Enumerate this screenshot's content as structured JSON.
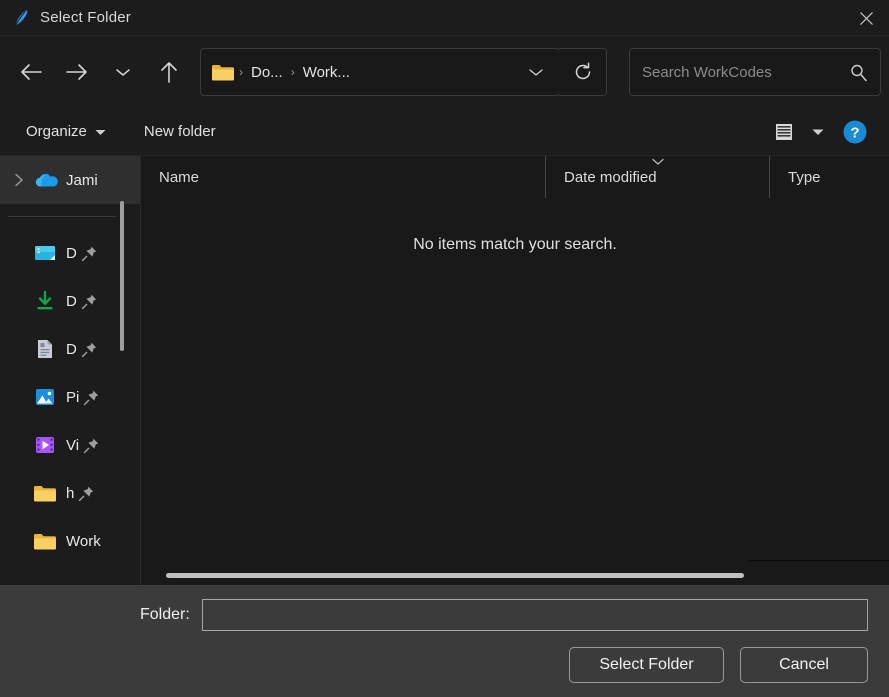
{
  "window": {
    "title": "Select Folder",
    "app_icon": "feather-icon",
    "close_label": "✕"
  },
  "nav": {
    "back": "back-arrow-icon",
    "forward": "forward-arrow-icon",
    "recent": "chevron-down-icon",
    "up": "up-arrow-icon",
    "refresh": "refresh-icon"
  },
  "address": {
    "folder_icon": "folder-icon",
    "crumbs": [
      "Do...",
      "Work..."
    ],
    "separator": "›",
    "dropdown": "chevron-down-icon"
  },
  "search": {
    "placeholder": "Search WorkCodes",
    "value": "",
    "icon": "search-icon"
  },
  "toolbar": {
    "organize_label": "Organize",
    "organize_caret": "caret-down-icon",
    "new_folder_label": "New folder",
    "layout_icon": "list-view-icon",
    "layout_caret": "caret-down-icon",
    "help_label": "?"
  },
  "sidebar": {
    "items": [
      {
        "label": "Jami",
        "icon": "onedrive-cloud-icon",
        "expandable": true,
        "selected": true,
        "pinned": false
      },
      {
        "label": "D",
        "icon": "desktop-icon",
        "expandable": false,
        "selected": false,
        "pinned": true
      },
      {
        "label": "D",
        "icon": "downloads-icon",
        "expandable": false,
        "selected": false,
        "pinned": true
      },
      {
        "label": "D",
        "icon": "documents-icon",
        "expandable": false,
        "selected": false,
        "pinned": true
      },
      {
        "label": "Pi",
        "icon": "pictures-icon",
        "expandable": false,
        "selected": false,
        "pinned": true
      },
      {
        "label": "Vi",
        "icon": "videos-icon",
        "expandable": false,
        "selected": false,
        "pinned": true
      },
      {
        "label": "h",
        "icon": "folder-icon",
        "expandable": false,
        "selected": false,
        "pinned": true
      },
      {
        "label": "Work",
        "icon": "folder-icon",
        "expandable": false,
        "selected": false,
        "pinned": false
      }
    ]
  },
  "filelist": {
    "columns": [
      "Name",
      "Date modified",
      "Type"
    ],
    "sorted_column": "Date modified",
    "sort_indicator": "chevron-up-icon",
    "rows": [],
    "empty_message": "No items match your search."
  },
  "footer": {
    "folder_label": "Folder:",
    "folder_value": "",
    "select_label": "Select Folder",
    "cancel_label": "Cancel"
  },
  "colors": {
    "background": "#1c1c1c",
    "pane": "#191919",
    "footer": "#3b3b3b",
    "accent": "#0a84d8",
    "text": "#e8e8e8",
    "folder_yellow": "#f5c244"
  }
}
